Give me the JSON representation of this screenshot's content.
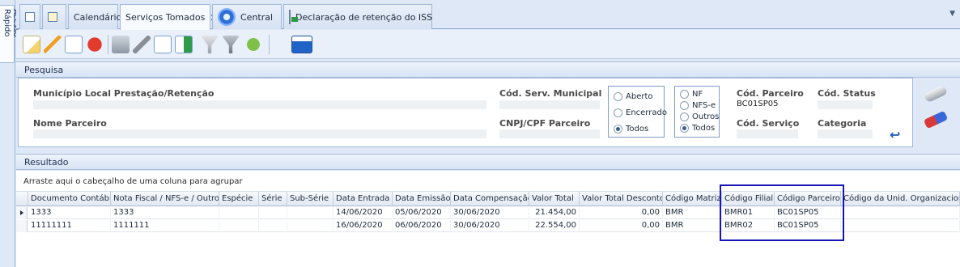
{
  "quick_access": "Acesso Rápido",
  "tabs": [
    {
      "label": ""
    },
    {
      "label": ""
    },
    {
      "label": "Calendário"
    },
    {
      "label": "Serviços Tomados"
    },
    {
      "label": "Central"
    },
    {
      "label": "Declaração de retenção do ISS"
    }
  ],
  "pesquisa": {
    "title": "Pesquisa",
    "municipio_label": "Município Local Prestação/Retenção",
    "nome_parceiro_label": "Nome Parceiro",
    "cod_serv_municipal_label": "Cód. Serv. Municipal",
    "cnpj_label": "CNPJ/CPF Parceiro",
    "status_options": [
      "Aberto",
      "Encerrado",
      "Todos"
    ],
    "status_selected": "Todos",
    "tipo_options": [
      "NF",
      "NFS-e",
      "Outros",
      "Todos"
    ],
    "tipo_selected": "Todos",
    "cod_parceiro_label": "Cód. Parceiro",
    "cod_parceiro_value": "BC01SP05",
    "cod_status_label": "Cód. Status",
    "cod_servico_label": "Cód. Serviço",
    "categoria_label": "Categoria"
  },
  "resultado": {
    "title": "Resultado",
    "group_hint": "Arraste aqui o cabeçalho de uma coluna para agrupar",
    "columns": [
      "Documento Contábil",
      "Nota Fiscal / NFS-e / Outros",
      "Espécie",
      "Série",
      "Sub-Série",
      "Data Entrada",
      "Data Emissão",
      "Data Compensação",
      "Valor Total",
      "Valor Total Desconto",
      "Código Matriz",
      "Código Filial",
      "Código Parceiro",
      "Código da Unid. Organizacional"
    ],
    "rows": [
      {
        "doc": "1333",
        "nf": "1333",
        "especie": "",
        "serie": "",
        "subserie": "",
        "entrada": "14/06/2020",
        "emissao": "05/06/2020",
        "compensacao": "30/06/2020",
        "valor_total": "21.454,00",
        "desconto": "0,00",
        "matriz": "BMR",
        "filial": "BMR01",
        "parceiro": "BC01SP05",
        "unid": ""
      },
      {
        "doc": "11111111",
        "nf": "1111111",
        "especie": "",
        "serie": "",
        "subserie": "",
        "entrada": "16/06/2020",
        "emissao": "06/06/2020",
        "compensacao": "30/06/2020",
        "valor_total": "22.554,00",
        "desconto": "0,00",
        "matriz": "BMR",
        "filial": "BMR02",
        "parceiro": "BC01SP05",
        "unid": ""
      }
    ]
  },
  "colors": {
    "highlight": "#1515b8",
    "accent": "#2f6fd6"
  }
}
